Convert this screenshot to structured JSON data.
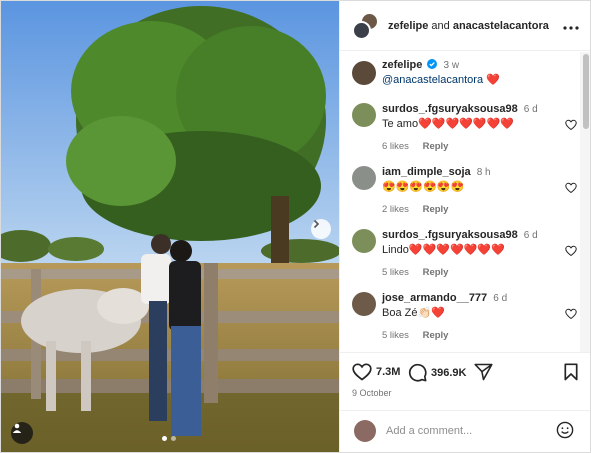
{
  "header": {
    "user1": "zefelipe",
    "joiner": "and",
    "user2": "anacastelacantora",
    "more_icon": "more-horizontal-icon"
  },
  "caption": {
    "username": "zefelipe",
    "time": "3 w",
    "mention": "@anacastelacantora",
    "emoji": "❤️"
  },
  "comments": [
    {
      "username": "surdos_.fgsuryaksousa98",
      "time": "6 d",
      "text": "Te amo❤️❤️❤️❤️❤️❤️❤️",
      "likes": "6 likes",
      "reply": "Reply"
    },
    {
      "username": "iam_dimple_soja",
      "time": "8 h",
      "text": "😍😍😍😍😍😍",
      "likes": "2 likes",
      "reply": "Reply"
    },
    {
      "username": "surdos_.fgsuryaksousa98",
      "time": "6 d",
      "text": "Lindo❤️❤️❤️❤️❤️❤️❤️",
      "likes": "5 likes",
      "reply": "Reply"
    },
    {
      "username": "jose_armando__777",
      "time": "6 d",
      "text": "Boa Zé👏🏻❤️",
      "likes": "5 likes",
      "reply": "Reply"
    }
  ],
  "actions": {
    "likes": "7.3M",
    "comments": "396.9K",
    "date": "9 October"
  },
  "add_comment": {
    "placeholder": "Add a comment..."
  },
  "colors": {
    "heart_red": "#ed4956",
    "link_blue": "#00376b",
    "verified_blue": "#0095f6"
  }
}
